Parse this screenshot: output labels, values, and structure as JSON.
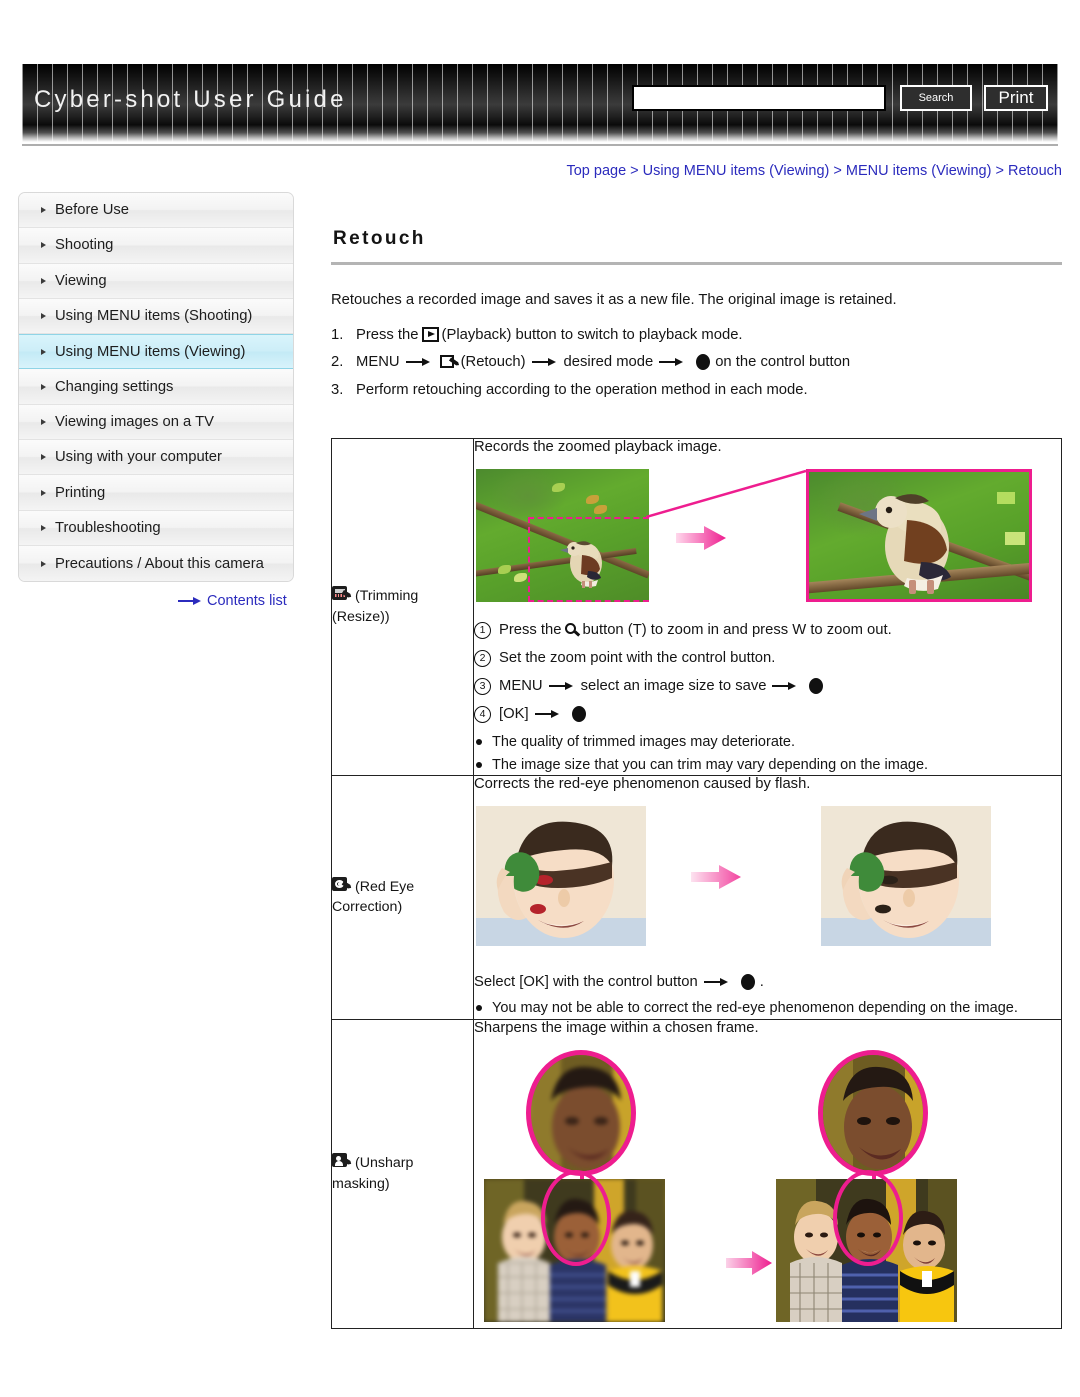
{
  "header": {
    "site_title": "Cyber-shot User Guide",
    "search_placeholder": "",
    "search_value": "",
    "search_button": "Search",
    "print_button": "Print"
  },
  "breadcrumb": {
    "items": [
      "Top page",
      "Using MENU items (Viewing)",
      "MENU items (Viewing)",
      "Retouch"
    ],
    "separator": ">",
    "link_color": "#2b2bbd"
  },
  "sidebar": {
    "items": [
      {
        "label": "Before Use",
        "active": false
      },
      {
        "label": "Shooting",
        "active": false
      },
      {
        "label": "Viewing",
        "active": false
      },
      {
        "label": "Using MENU items (Shooting)",
        "active": false
      },
      {
        "label": "Using MENU items (Viewing)",
        "active": true
      },
      {
        "label": "Changing settings",
        "active": false
      },
      {
        "label": "Viewing images on a TV",
        "active": false
      },
      {
        "label": "Using with your computer",
        "active": false
      },
      {
        "label": "Printing",
        "active": false
      },
      {
        "label": "Troubleshooting",
        "active": false
      },
      {
        "label": "Precautions / About this camera",
        "active": false
      }
    ],
    "contents_link": "Contents list",
    "active_color": "#cdeef8"
  },
  "main": {
    "title": "Retouch",
    "intro": "Retouches a recorded image and saves it as a new file. The original image is retained.",
    "steps": [
      {
        "num": "1.",
        "parts": [
          {
            "type": "text",
            "value": "Press the"
          },
          {
            "type": "icon",
            "name": "playback-icon"
          },
          {
            "type": "text",
            "value": "(Playback) button to switch to playback mode."
          }
        ]
      },
      {
        "num": "2.",
        "parts": [
          {
            "type": "text",
            "value": "MENU"
          },
          {
            "type": "icon",
            "name": "arrow-right-icon"
          },
          {
            "type": "icon",
            "name": "retouch-icon"
          },
          {
            "type": "text",
            "value": "(Retouch)"
          },
          {
            "type": "icon",
            "name": "arrow-right-icon"
          },
          {
            "type": "text",
            "value": "desired mode"
          },
          {
            "type": "icon",
            "name": "arrow-right-icon"
          },
          {
            "type": "icon",
            "name": "control-button-dot-icon"
          },
          {
            "type": "text",
            "value": "on the control button"
          }
        ]
      },
      {
        "num": "3.",
        "parts": [
          {
            "type": "text",
            "value": "Perform retouching according to the operation method in each mode."
          }
        ]
      }
    ]
  },
  "modes": [
    {
      "icon": "trimming-icon",
      "label_line1": "(Trimming",
      "label_line2": "(Resize))",
      "description": "Records the zoomed playback image.",
      "figure": "bird-trim-figure",
      "numbered_steps": [
        {
          "n": "1",
          "pre": "Press the",
          "icon": "magnifier-icon",
          "post": "button (T) to zoom in and press W to zoom out."
        },
        {
          "n": "2",
          "pre": "Set the zoom point with the control button.",
          "icon": "",
          "post": ""
        },
        {
          "n": "3",
          "pre": "MENU",
          "icon": "arrow-dot",
          "post": "select an image size to save"
        },
        {
          "n": "4",
          "pre": "[OK]",
          "icon": "arrow-dot2",
          "post": ""
        }
      ],
      "notes": [
        "The quality of trimmed images may deteriorate.",
        "The image size that you can trim may vary depending on the image."
      ]
    },
    {
      "icon": "red-eye-icon",
      "label_line1": "(Red Eye",
      "label_line2": "Correction)",
      "description": "Corrects the red-eye phenomenon caused by flash.",
      "figure": "red-eye-figure",
      "select_text_pre": "Select [OK] with the control button",
      "select_text_post": ".",
      "notes": [
        "You may not be able to correct the red-eye phenomenon depending on the image."
      ]
    },
    {
      "icon": "unsharp-mask-icon",
      "label_line1": "(Unsharp",
      "label_line2": "masking)",
      "description": "Sharpens the image within a chosen frame.",
      "figure": "unsharp-figure",
      "notes": []
    }
  ],
  "colors": {
    "accent_pink": "#ee1d8f",
    "link_blue": "#2b2bbd",
    "header_black": "#0a0a0a",
    "highlight_blue": "#cdeef8"
  }
}
